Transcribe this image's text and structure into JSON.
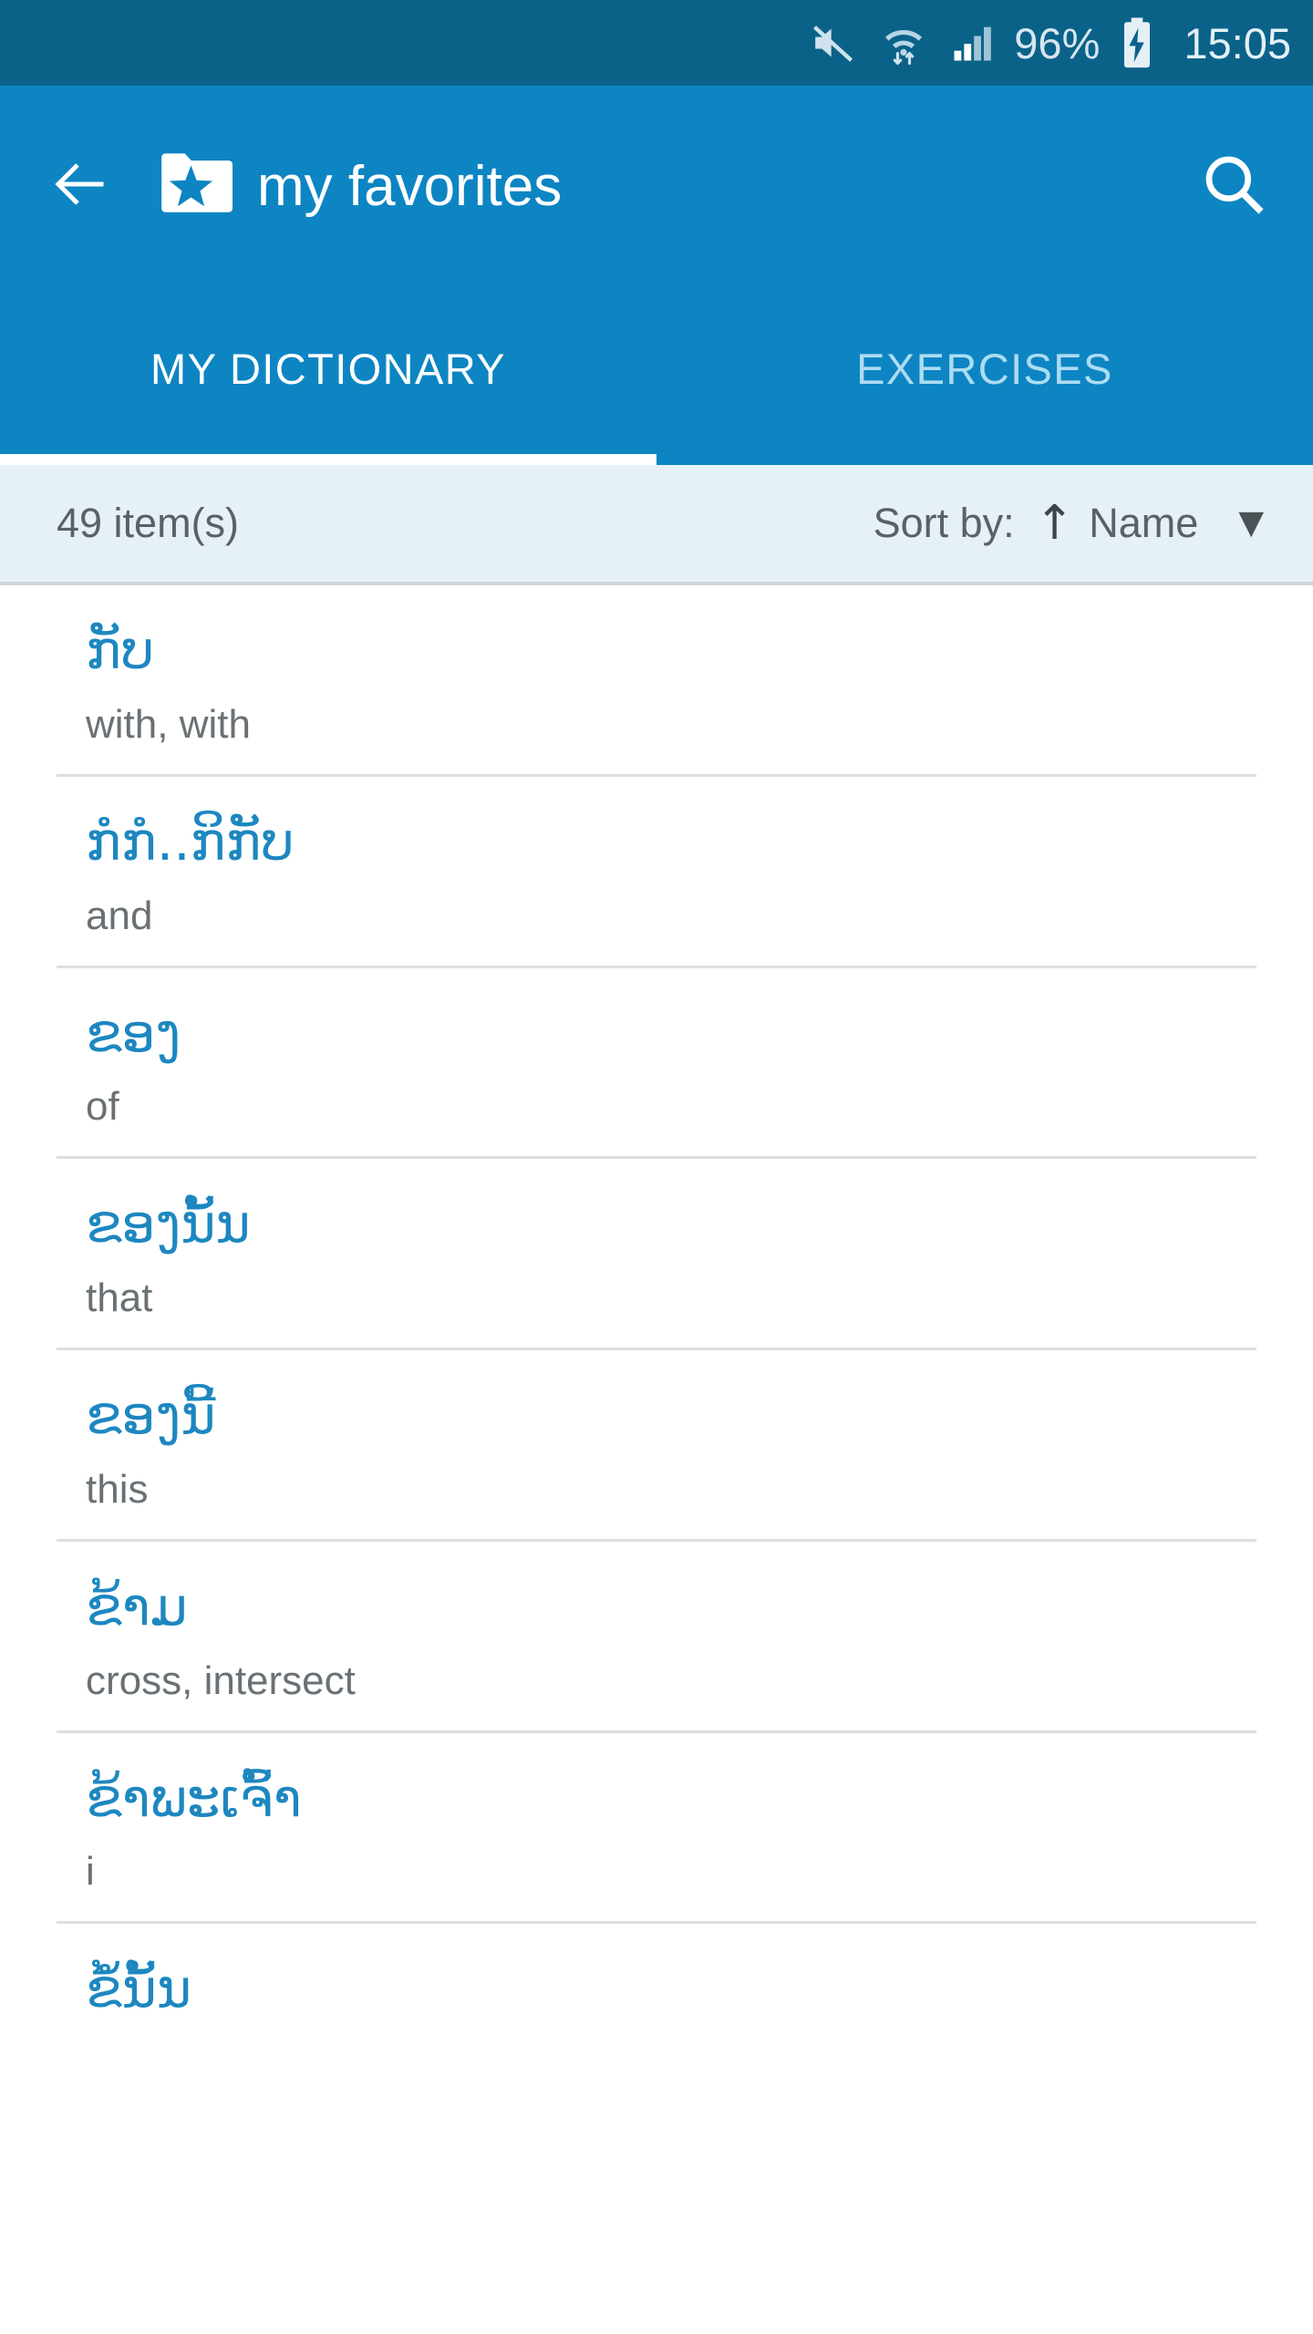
{
  "status_bar": {
    "mute_icon": "mute-icon",
    "wifi_icon": "wifi-transfer-icon",
    "signal_icon": "cellular-signal-icon",
    "battery_percent": "96%",
    "battery_icon": "battery-charging-icon",
    "time": "15:05",
    "background_color": "#0b6289"
  },
  "app_bar": {
    "back_icon": "back-arrow-icon",
    "folder_icon": "favorites-folder-star-icon",
    "title": "my favorites",
    "search_icon": "search-icon",
    "background_color": "#0d85c3"
  },
  "tabs": {
    "active_index": 0,
    "items": [
      {
        "label": "MY DICTIONARY"
      },
      {
        "label": "EXERCISES"
      }
    ]
  },
  "sort_bar": {
    "item_count": "49 item(s)",
    "sort_label": "Sort by:",
    "sort_direction_icon": "arrow-up-icon",
    "sort_direction_glyph": "↑",
    "sort_value": "Name",
    "dropdown_glyph": "▼",
    "background_color": "#e5f1f7"
  },
  "list": {
    "term_color": "#1d87c0",
    "translation_color": "#6a7175",
    "items": [
      {
        "term": "ກັບ",
        "translation": "with, with"
      },
      {
        "term": "ກໍກໍ..ກິກັບ",
        "translation": "and"
      },
      {
        "term": "ຂອງ",
        "translation": "of"
      },
      {
        "term": "ຂອງນັ້ນ",
        "translation": "that"
      },
      {
        "term": "ຂອງນີ້",
        "translation": "this"
      },
      {
        "term": "ຂ້າມ",
        "translation": "cross, intersect"
      },
      {
        "term": "ຂ້າພະເຈົ້າ",
        "translation": "i"
      },
      {
        "term": "ຂໍ້ນັ້ນ",
        "translation": ""
      }
    ]
  }
}
